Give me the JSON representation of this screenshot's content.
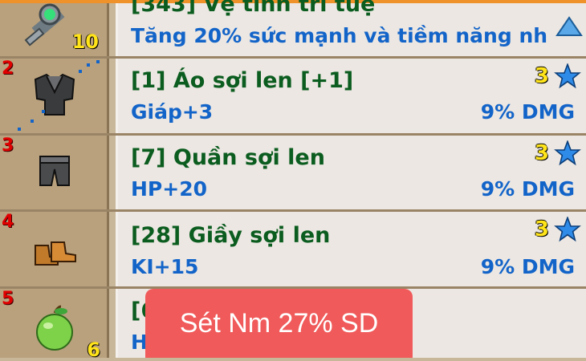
{
  "items": [
    {
      "slot": "",
      "qty": "10",
      "name": "[343] Vệ tinh trí tuệ",
      "stat": "Tăng 20% sức mạnh và tiềm năng nh",
      "dmg": "",
      "level": "",
      "icon": "satellite-icon"
    },
    {
      "slot": "2",
      "qty": "",
      "name": "[1] Áo sợi len [+1]",
      "stat": "Giáp+3",
      "dmg": "9% DMG",
      "level": "3",
      "icon": "wool-shirt-icon"
    },
    {
      "slot": "3",
      "qty": "",
      "name": "[7] Quần sợi len",
      "stat": "HP+20",
      "dmg": "9% DMG",
      "level": "3",
      "icon": "wool-pants-icon"
    },
    {
      "slot": "4",
      "qty": "",
      "name": "[28] Giầy sợi len",
      "stat": "KI+15",
      "dmg": "9% DMG",
      "level": "3",
      "icon": "wool-boots-icon"
    },
    {
      "slot": "5",
      "qty": "6",
      "name": "[6",
      "stat": "H",
      "dmg": "",
      "level": "",
      "icon": "green-apple-icon"
    }
  ],
  "toast": "Sét Nm 27% SD",
  "colors": {
    "name": "#0b5c1f",
    "stat": "#1364c9",
    "slot_number": "#e10000",
    "level": "#ffe41a",
    "toast_bg": "#f05a5a"
  }
}
